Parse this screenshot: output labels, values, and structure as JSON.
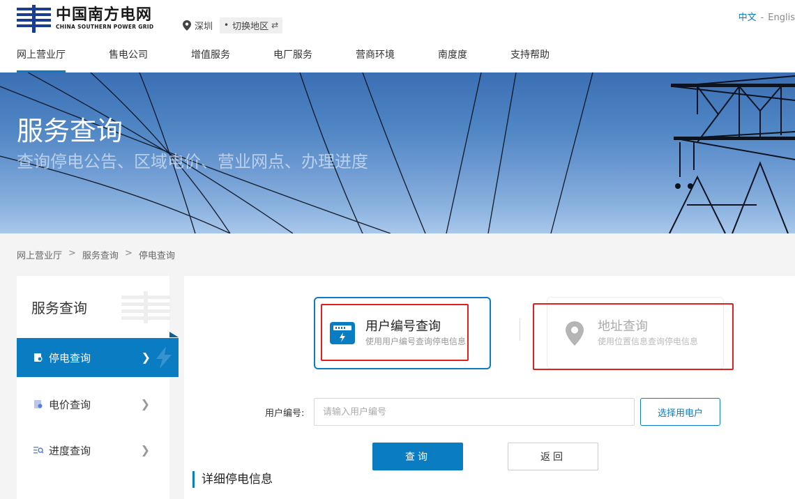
{
  "header": {
    "logo_cn": "中国南方电网",
    "logo_en": "CHINA SOUTHERN POWER GRID",
    "city": "深圳",
    "switch_region": "切换地区",
    "lang_cn": "中文",
    "lang_sep": "-",
    "lang_en": "Englis"
  },
  "nav": [
    {
      "label": "网上营业厅",
      "active": true
    },
    {
      "label": "售电公司"
    },
    {
      "label": "增值服务"
    },
    {
      "label": "电厂服务"
    },
    {
      "label": "营商环境"
    },
    {
      "label": "南度度"
    },
    {
      "label": "支持帮助"
    }
  ],
  "banner": {
    "title": "服务查询",
    "subtitle": "查询停电公告、区域电价、营业网点、办理进度"
  },
  "breadcrumb": [
    "网上营业厅",
    "服务查询",
    "停电查询"
  ],
  "breadcrumb_sep": ">",
  "sidebar": {
    "title": "服务查询",
    "items": [
      {
        "label": "停电查询",
        "active": true
      },
      {
        "label": "电价查询"
      },
      {
        "label": "进度查询"
      }
    ]
  },
  "query_types": {
    "user": {
      "title": "用户编号查询",
      "desc": "使用用户编号查询停电信息"
    },
    "addr": {
      "title": "地址查询",
      "desc": "使用位置信息查询停电信息"
    }
  },
  "form": {
    "label": "用户编号:",
    "placeholder": "请输入用户编号",
    "value": "",
    "select_user": "选择用电户",
    "query": "查询",
    "back": "返回"
  },
  "section_title": "详细停电信息",
  "colors": {
    "primary": "#0a7cc2",
    "highlight_box": "#e0201f"
  }
}
